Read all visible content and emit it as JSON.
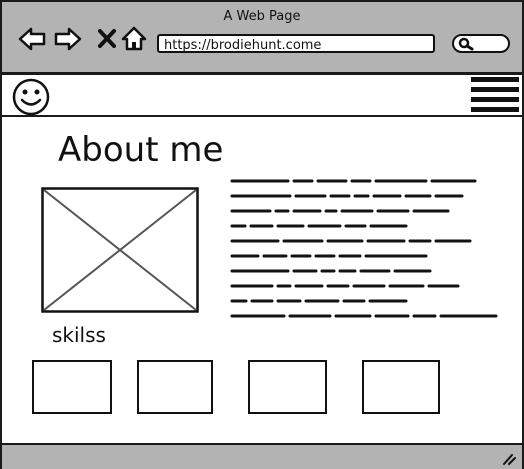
{
  "browser": {
    "title": "A Web Page",
    "url": "https://brodiehunt.come",
    "back_icon": "back-arrow-icon",
    "forward_icon": "forward-arrow-icon",
    "stop_icon": "close-icon",
    "home_icon": "home-icon",
    "search_icon": "search-icon"
  },
  "navbar": {
    "logo_icon": "smiley-icon",
    "menu_icon": "hamburger-menu-icon"
  },
  "main": {
    "heading": "About me",
    "skills_label": "skilss",
    "skill_boxes": 4
  }
}
